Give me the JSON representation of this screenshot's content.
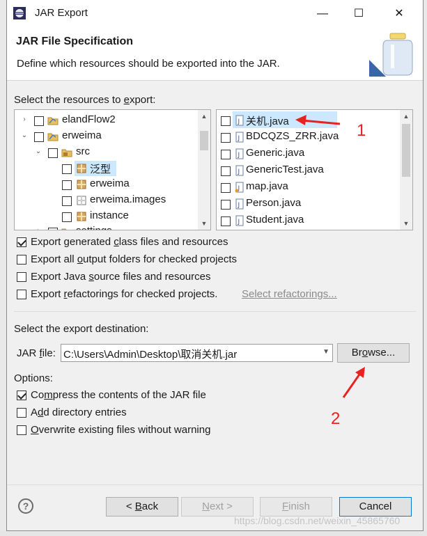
{
  "window": {
    "title": "JAR Export",
    "controls": {
      "minimize": "—",
      "maximize": "☐",
      "close": "✕"
    }
  },
  "header": {
    "title": "JAR File Specification",
    "description": "Define which resources should be exported into the JAR."
  },
  "resources": {
    "label_prefix": "Select the resources to ",
    "label_mnemonic": "e",
    "label_suffix": "xport:",
    "tree": [
      {
        "label": "elandFlow2",
        "twist": "›",
        "checked": false,
        "icon": "project-icon"
      },
      {
        "label": "erweima",
        "twist": "⌄",
        "checked": false,
        "icon": "project-icon"
      },
      {
        "label": "src",
        "twist": "⌄",
        "checked": false,
        "icon": "source-folder-icon"
      },
      {
        "label": "泛型",
        "twist": "",
        "checked": false,
        "icon": "package-icon",
        "selected": true
      },
      {
        "label": "erweima",
        "twist": "",
        "checked": false,
        "icon": "package-icon"
      },
      {
        "label": "erweima.images",
        "twist": "",
        "checked": false,
        "icon": "empty-package-icon"
      },
      {
        "label": "instance",
        "twist": "",
        "checked": false,
        "icon": "package-icon"
      },
      {
        "label": "settings",
        "twist": "›",
        "checked": false,
        "icon": "folder-icon"
      }
    ],
    "files": [
      {
        "label": "关机.java",
        "checked": false,
        "icon": "java-file-icon",
        "selected": true
      },
      {
        "label": "BDCQZS_ZRR.java",
        "checked": false,
        "icon": "java-file-icon"
      },
      {
        "label": "Generic.java",
        "checked": false,
        "icon": "java-file-icon"
      },
      {
        "label": "GenericTest.java",
        "checked": false,
        "icon": "java-file-icon"
      },
      {
        "label": "map.java",
        "checked": false,
        "icon": "java-file-icon"
      },
      {
        "label": "Person.java",
        "checked": false,
        "icon": "java-file-icon"
      },
      {
        "label": "Student.java",
        "checked": false,
        "icon": "java-file-icon"
      }
    ]
  },
  "options_top": [
    {
      "pre": "Export generated ",
      "mn": "c",
      "post": "lass files and resources",
      "checked": true
    },
    {
      "pre": "Export all ",
      "mn": "o",
      "post": "utput folders for checked projects",
      "checked": false
    },
    {
      "pre": "Export Java ",
      "mn": "s",
      "post": "ource files and resources",
      "checked": false
    },
    {
      "pre": "Export ",
      "mn": "r",
      "post": "efactorings for checked projects.",
      "checked": false
    }
  ],
  "select_refactorings_link": "Select refactorings...",
  "destination": {
    "label": "Select the export destination:",
    "jar_label_pre": "JAR ",
    "jar_label_mn": "f",
    "jar_label_post": "ile:",
    "jar_value": "C:\\Users\\Admin\\Desktop\\取消关机.jar",
    "browse_pre": "Br",
    "browse_mn": "o",
    "browse_post": "wse..."
  },
  "options": {
    "label": "Options:",
    "items": [
      {
        "pre": "Co",
        "mn": "m",
        "post": "press the contents of the JAR file",
        "checked": true
      },
      {
        "pre": "A",
        "mn": "d",
        "post": "d directory entries",
        "checked": false
      },
      {
        "pre": "",
        "mn": "O",
        "post": "verwrite existing files without warning",
        "checked": false
      }
    ]
  },
  "footer": {
    "help": "?",
    "back_pre": "< ",
    "back_mn": "B",
    "back_post": "ack",
    "next_mn": "N",
    "next_post": "ext >",
    "finish_mn": "F",
    "finish_post": "inish",
    "cancel": "Cancel"
  },
  "annotations": {
    "one": "1",
    "two": "2"
  },
  "watermark": "https://blog.csdn.net/weixin_45865760",
  "colors": {
    "annotation_red": "#e8231f",
    "selection_blue": "#cce8ff",
    "default_button_border": "#0078d7"
  }
}
